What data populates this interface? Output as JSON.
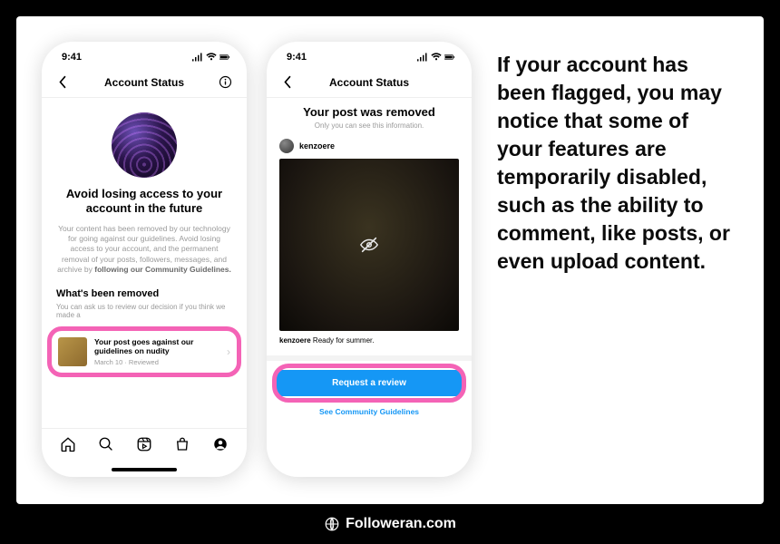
{
  "statusbar": {
    "time": "9:41"
  },
  "phone1": {
    "nav_title": "Account Status",
    "headline": "Avoid losing access to your account in the future",
    "body_a": "Your content has been removed by our technology for going against our guidelines. Avoid losing access to your account, and the permanent removal of your posts, followers, messages, and archive by ",
    "body_strong": "following our Community Guidelines.",
    "section": "What's been removed",
    "section_sub": "You can ask us to review our decision if you think we made a",
    "row_title": "Your post goes against our guidelines on nudity",
    "row_meta": "March 10 · Reviewed"
  },
  "phone2": {
    "nav_title": "Account Status",
    "headline": "Your post was removed",
    "sub": "Only you can see this information.",
    "username": "kenzoere",
    "caption_user": "kenzoere",
    "caption_text": " Ready for summer.",
    "button": "Request a review",
    "link": "See Community Guidelines"
  },
  "explain": {
    "text": "If your account has been flagged, you may notice that some of your features are temporarily disabled, such as the ability to comment, like posts, or even upload content."
  },
  "footer": {
    "brand": "Followeran.com"
  }
}
